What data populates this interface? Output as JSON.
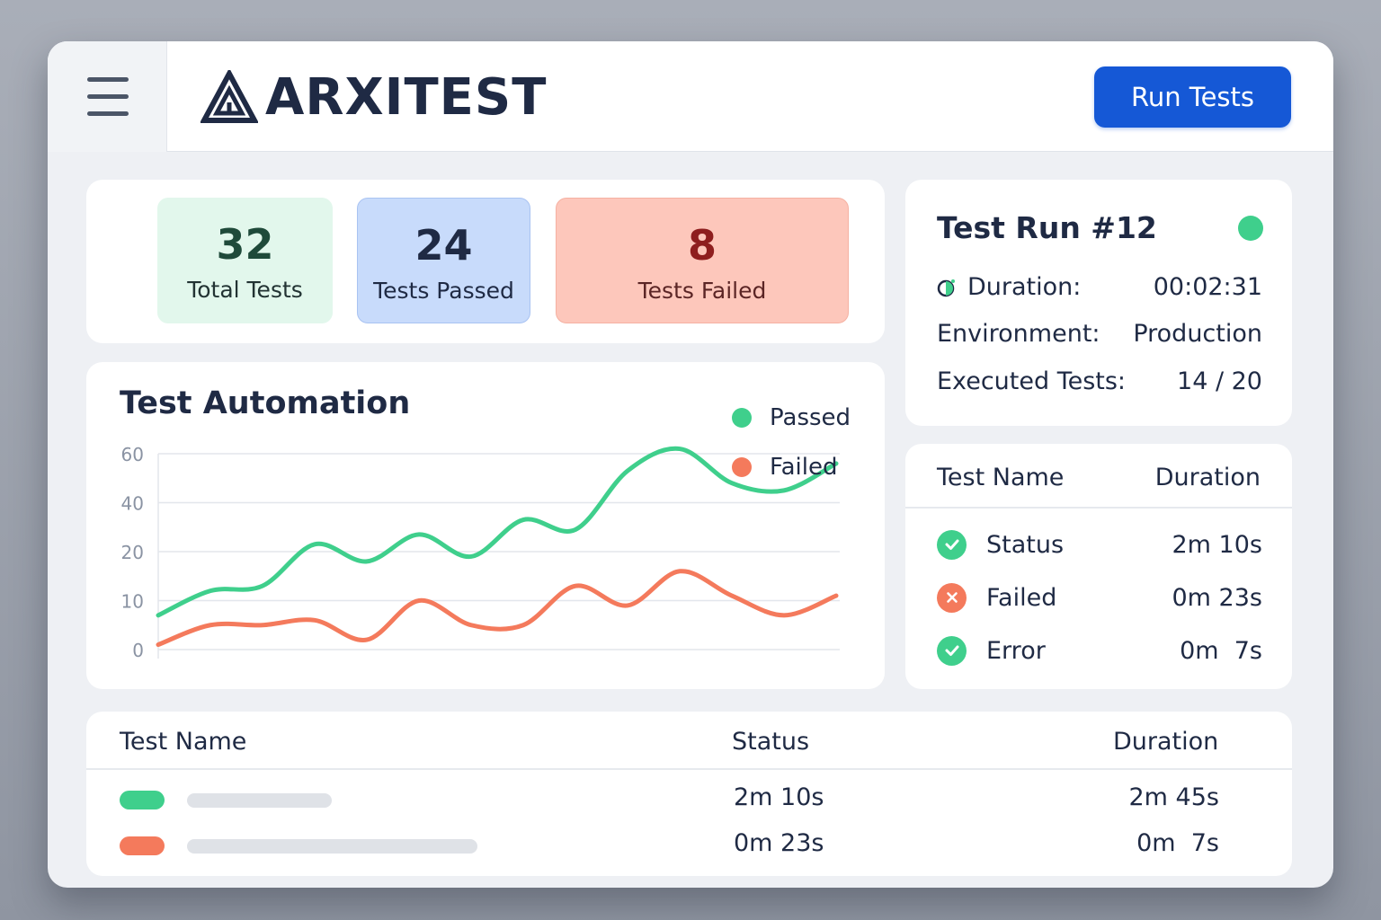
{
  "app": {
    "logo_text": "ARXITEST",
    "run_button": "Run Tests"
  },
  "colors": {
    "accent": "#1558d6",
    "passed": "#3fcf8c",
    "failed": "#f47a5c"
  },
  "stats": [
    {
      "value": "32",
      "label": "Total Tests"
    },
    {
      "value": "24",
      "label": "Tests Passed"
    },
    {
      "value": "8",
      "label": "Tests Failed"
    }
  ],
  "chart": {
    "title": "Test Automation"
  },
  "chart_data": {
    "type": "line",
    "title": "Test Automation",
    "y_ticks": [
      "60",
      "40",
      "20",
      "10",
      "0"
    ],
    "ylim": [
      0,
      60
    ],
    "grid": true,
    "legend_placement": "top-right",
    "x": [
      1,
      2,
      3,
      4,
      5,
      6,
      7,
      8,
      9,
      10,
      11,
      12,
      13,
      14
    ],
    "series": [
      {
        "name": "Passed",
        "color": "#3fcf8c",
        "values": [
          7,
          12,
          13,
          23,
          18,
          27,
          19,
          33,
          29,
          53,
          62,
          48,
          45,
          56
        ]
      },
      {
        "name": "Failed",
        "color": "#f47a5c",
        "values": [
          1,
          5,
          5,
          6,
          2,
          10,
          5,
          5,
          13,
          9,
          16,
          11,
          7,
          11
        ]
      }
    ]
  },
  "run": {
    "title": "Test Run #12",
    "rows": [
      {
        "key": "Duration:",
        "value": "00:02:31"
      },
      {
        "key": "Environment:",
        "value": "Production"
      },
      {
        "key": "Executed Tests:",
        "value": "14 / 20"
      }
    ]
  },
  "mini_table": {
    "headers": {
      "name": "Test Name",
      "duration": "Duration"
    },
    "rows": [
      {
        "name": "Status",
        "duration": "2m 10s",
        "icon": "check-icon",
        "color": "#3fcf8c"
      },
      {
        "name": "Failed",
        "duration": "0m 23s",
        "icon": "x-icon",
        "color": "#f47a5c"
      },
      {
        "name": "Error",
        "duration": "0m  7s",
        "icon": "check-icon",
        "color": "#3fcf8c"
      }
    ]
  },
  "results_table": {
    "headers": {
      "name": "Test Name",
      "status": "Status",
      "duration": "Duration"
    },
    "rows": [
      {
        "status": "2m 10s",
        "duration": "2m 45s",
        "color": "#3fcf8c"
      },
      {
        "status": "0m 23s",
        "duration": "0m  7s",
        "color": "#f47a5c"
      }
    ]
  }
}
